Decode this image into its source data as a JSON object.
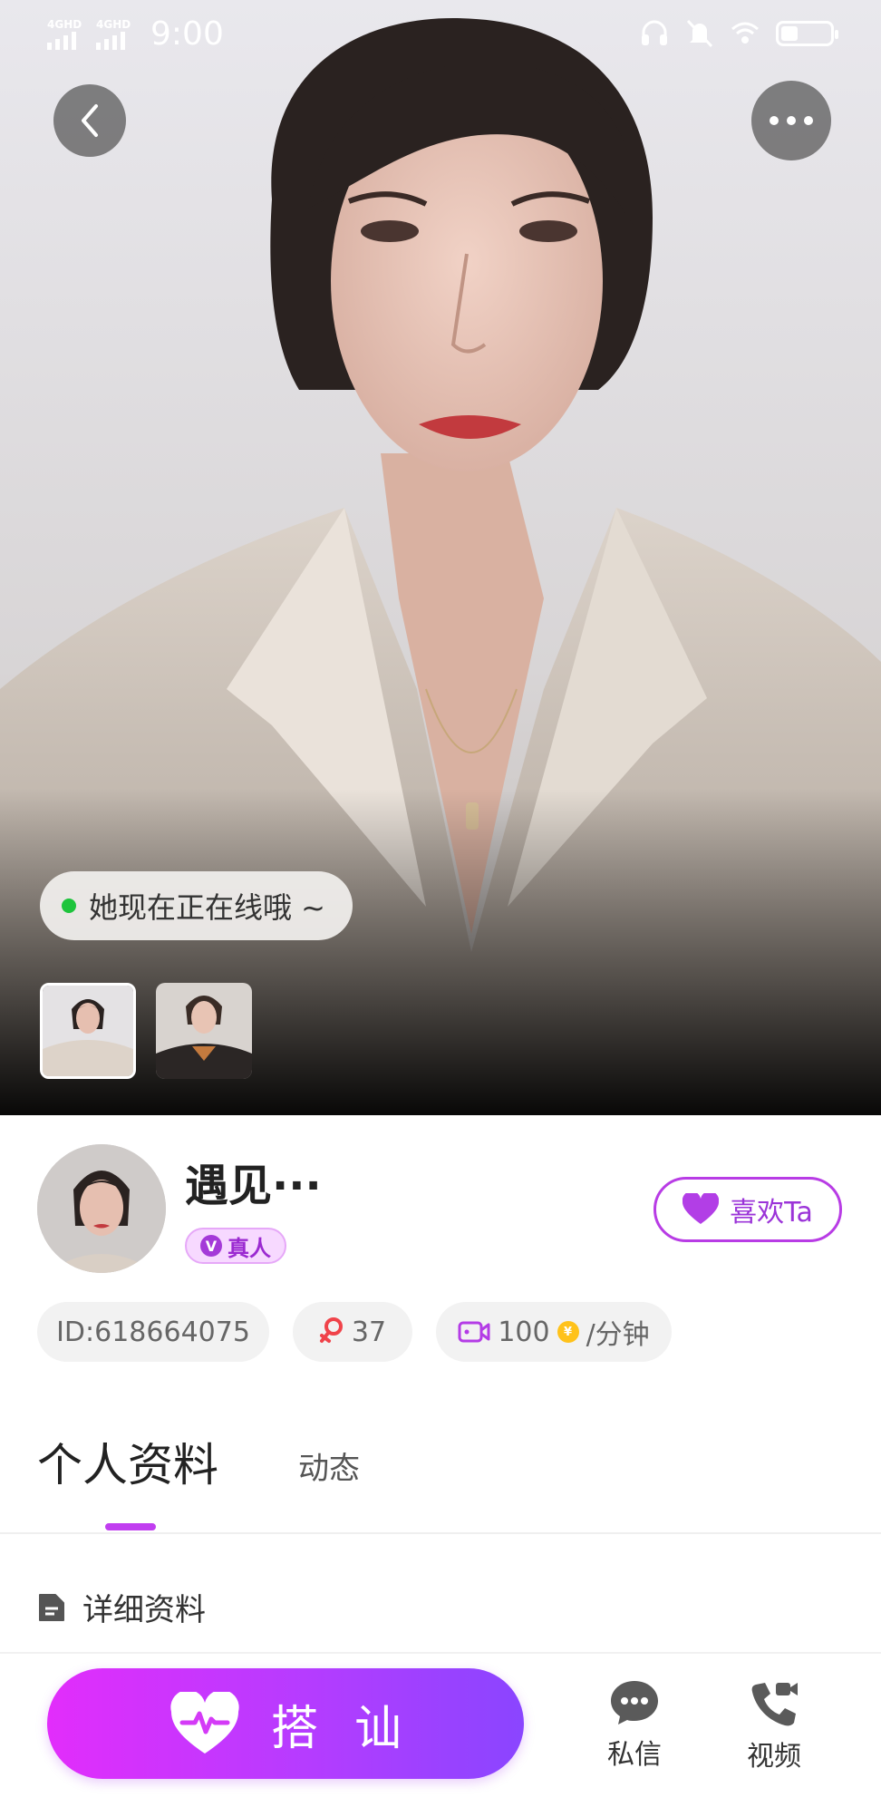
{
  "status_bar": {
    "network_1": "4GHD",
    "network_2": "4GHD",
    "time": "9:00",
    "icons": [
      "headset-icon",
      "bell-muted-icon",
      "wifi-icon",
      "battery-icon"
    ]
  },
  "hero": {
    "online_status": "她现在正在线哦 ~",
    "thumbnails_count": 2,
    "online_dot_color": "#1ec43c"
  },
  "profile": {
    "name": "遇见···",
    "verified_badge": "真人",
    "verified_letter": "V",
    "like_button": "喜欢Ta",
    "id_label": "ID:618664075",
    "fans_count": "37",
    "price_value": "100",
    "coin_symbol": "¥",
    "price_unit": "/分钟"
  },
  "tabs": {
    "profile": "个人资料",
    "moments": "动态"
  },
  "section": {
    "details_title": "详细资料"
  },
  "bottom_bar": {
    "chat_up": "搭讪",
    "message": "私信",
    "video": "视频"
  },
  "colors": {
    "accent": "#c13ef0",
    "gradient_start": "#e22dfb",
    "gradient_end": "#8a45ff",
    "coin": "#ffc21a"
  }
}
